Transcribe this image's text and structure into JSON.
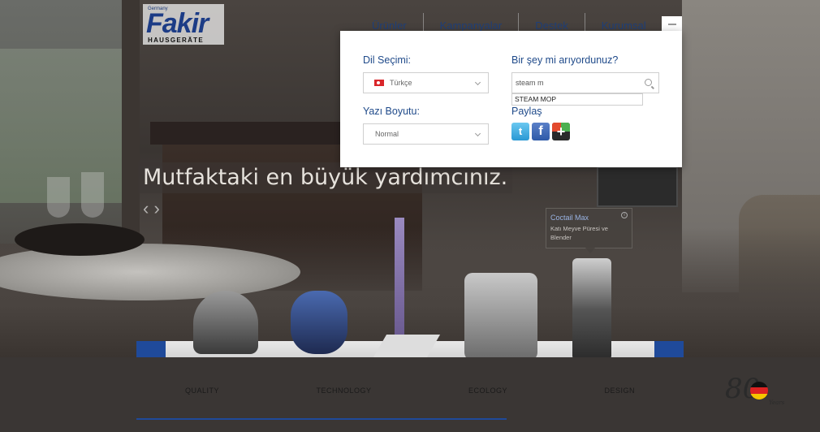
{
  "header": {
    "logo_tag": "Germany",
    "logo_word": "Fakir",
    "logo_sub": "HAUSGERÄTE",
    "nav": [
      "Ürünler",
      "Kampanyalar",
      "Destek",
      "Kurumsal"
    ]
  },
  "slide": {
    "headline": "Mutfaktaki en büyük yardımcınız.",
    "arrows": "‹ ›"
  },
  "product_tooltip": {
    "title": "Coctail Max",
    "description": "Katı Meyve Püresi ve Blender",
    "info": "i"
  },
  "bottom_tabs": [
    "QUALITY",
    "TECHNOLOGY",
    "ECOLOGY",
    "DESIGN"
  ],
  "badge": {
    "number": "80",
    "label": "Years"
  },
  "popup": {
    "language_label": "Dil Seçimi:",
    "language_value": "Türkçe",
    "font_size_label": "Yazı Boyutu:",
    "font_size_value": "Normal",
    "search_label": "Bir şey mi arıyordunuz?",
    "search_value": "steam m",
    "suggestion": "STEAM MOP",
    "share_label": "Paylaş",
    "share_icons": [
      "twitter-icon",
      "facebook-icon",
      "plus-icon"
    ],
    "twitter_glyph": "t",
    "facebook_glyph": "f",
    "plus_glyph": "+"
  },
  "colors": {
    "brand_blue": "#1c3c86",
    "label_blue": "#1f4a8a",
    "accent_blue": "#1f4a9a"
  }
}
